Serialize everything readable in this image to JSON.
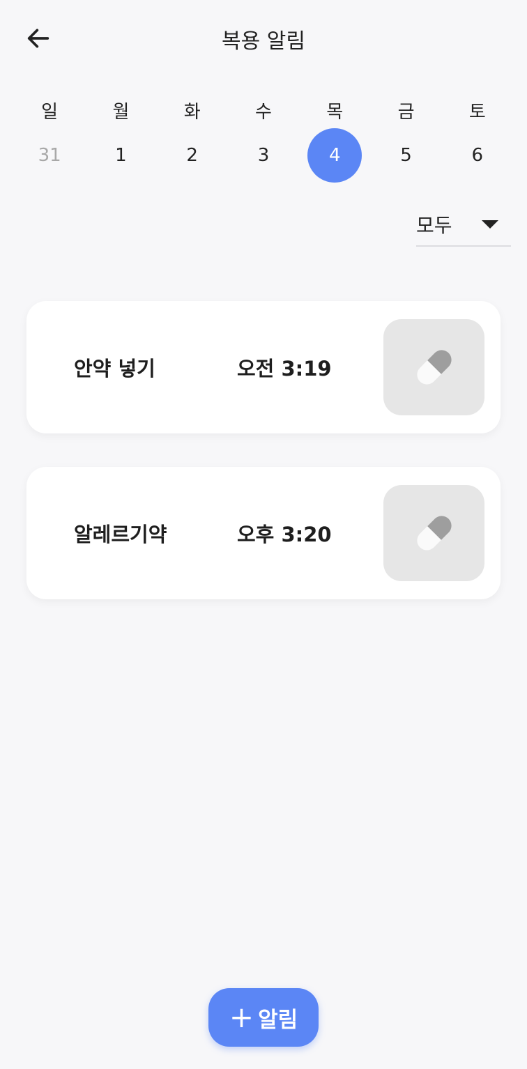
{
  "header": {
    "title": "복용 알림",
    "back_icon": "arrow-left-icon"
  },
  "calendar": {
    "weekdays": [
      "일",
      "월",
      "화",
      "수",
      "목",
      "금",
      "토"
    ],
    "dates": [
      {
        "label": "31",
        "muted": true,
        "selected": false
      },
      {
        "label": "1",
        "muted": false,
        "selected": false
      },
      {
        "label": "2",
        "muted": false,
        "selected": false
      },
      {
        "label": "3",
        "muted": false,
        "selected": false
      },
      {
        "label": "4",
        "muted": false,
        "selected": true
      },
      {
        "label": "5",
        "muted": false,
        "selected": false
      },
      {
        "label": "6",
        "muted": false,
        "selected": false
      }
    ],
    "accent_color": "#5b86f5"
  },
  "filter": {
    "selected": "모두",
    "icon": "caret-down-icon"
  },
  "alarms": [
    {
      "name": "안약 넣기",
      "time": "오전 3:19",
      "icon": "pill-icon"
    },
    {
      "name": "알레르기약",
      "time": "오후 3:20",
      "icon": "pill-icon"
    }
  ],
  "fab": {
    "plus": "+",
    "label": "알림"
  }
}
